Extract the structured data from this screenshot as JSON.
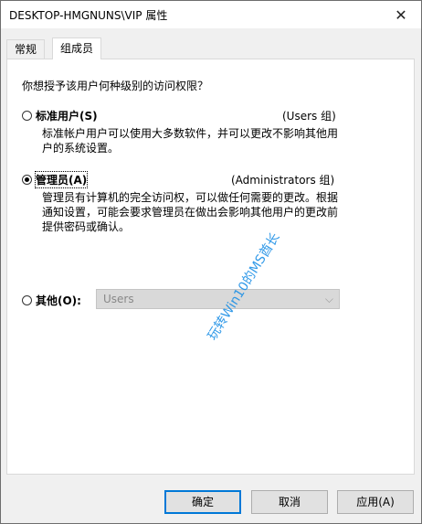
{
  "window": {
    "title": "DESKTOP-HMGNUNS\\VIP 属性",
    "close_label": "✕"
  },
  "tabs": [
    {
      "label": "常规"
    },
    {
      "label": "组成员"
    }
  ],
  "panel": {
    "question": "你想授予该用户何种级别的访问权限？",
    "options": [
      {
        "label": "标准用户(S)",
        "group": "(Users 组)",
        "desc_line1": "标准帐户用户可以使用大多数软件，并可以更改不影响其他用",
        "desc_line2": "户的系统设置。",
        "checked": false
      },
      {
        "label": "管理员(A)",
        "group": "(Administrators 组)",
        "desc_line1": "管理员有计算机的完全访问权，可以做任何需要的更改。根据",
        "desc_line2": "通知设置，可能会要求管理员在做出会影响其他用户的更改前",
        "desc_line3": "提供密码或确认。",
        "checked": true
      },
      {
        "label": "其他(O):",
        "checked": false
      }
    ],
    "other_combo": {
      "value": "Users",
      "arrow": "⌵"
    },
    "watermark": "玩转Win10的MS酋长"
  },
  "buttons": {
    "ok": "确定",
    "cancel": "取消",
    "apply": "应用(A)"
  },
  "colors": {
    "accent": "#0078d7",
    "watermark": "#1b8fe6"
  }
}
